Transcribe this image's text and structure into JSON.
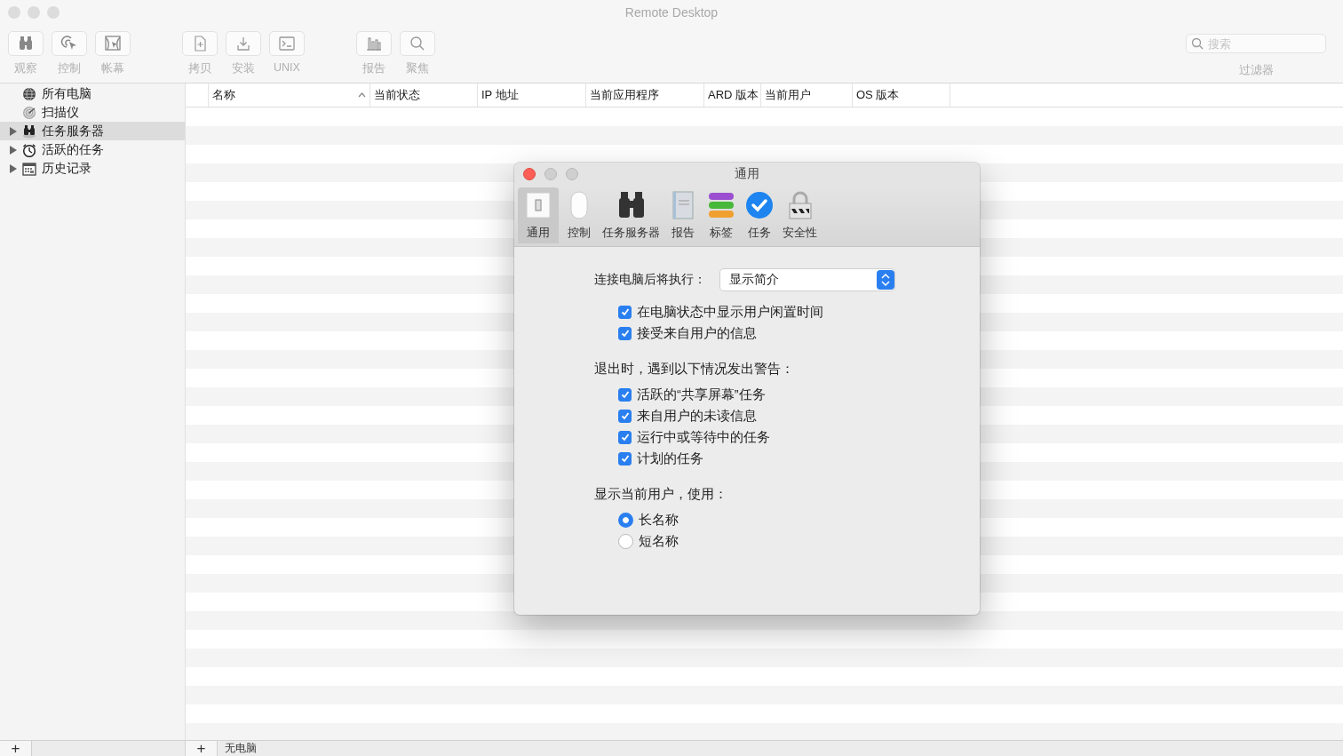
{
  "window": {
    "title": "Remote Desktop"
  },
  "toolbar": {
    "groups": [
      [
        {
          "label": "观察"
        },
        {
          "label": "控制"
        },
        {
          "label": "帐幕"
        }
      ],
      [
        {
          "label": "拷贝"
        },
        {
          "label": "安装"
        },
        {
          "label": "UNIX"
        }
      ],
      [
        {
          "label": "报告"
        },
        {
          "label": "聚焦"
        }
      ]
    ],
    "search": {
      "placeholder": "搜索",
      "label": "过滤器"
    }
  },
  "sidebar": {
    "items": [
      {
        "label": "所有电脑",
        "expandable": false,
        "selected": false
      },
      {
        "label": "扫描仪",
        "expandable": false,
        "selected": false
      },
      {
        "label": "任务服务器",
        "expandable": true,
        "selected": true
      },
      {
        "label": "活跃的任务",
        "expandable": true,
        "selected": false
      },
      {
        "label": "历史记录",
        "expandable": true,
        "selected": false
      }
    ]
  },
  "table": {
    "columns": [
      {
        "label": "名称",
        "sorted": true
      },
      {
        "label": "当前状态",
        "sorted": false
      },
      {
        "label": "IP 地址",
        "sorted": false
      },
      {
        "label": "当前应用程序",
        "sorted": false
      },
      {
        "label": "ARD 版本",
        "sorted": false
      },
      {
        "label": "当前用户",
        "sorted": false
      },
      {
        "label": "OS 版本",
        "sorted": false
      }
    ]
  },
  "status_bar": {
    "left_button": "+",
    "right_button": "+",
    "text": "无电脑"
  },
  "dialog": {
    "title": "通用",
    "tabs": [
      {
        "label": "通用",
        "selected": true
      },
      {
        "label": "控制",
        "selected": false
      },
      {
        "label": "任务服务器",
        "selected": false
      },
      {
        "label": "报告",
        "selected": false
      },
      {
        "label": "标签",
        "selected": false
      },
      {
        "label": "任务",
        "selected": false
      },
      {
        "label": "安全性",
        "selected": false
      }
    ],
    "popup": {
      "label": "连接电脑后将执行：",
      "value": "显示简介"
    },
    "options": [
      {
        "label": "在电脑状态中显示用户闲置时间",
        "checked": true
      },
      {
        "label": "接受来自用户的信息",
        "checked": true
      }
    ],
    "warnings_heading": "退出时，遇到以下情况发出警告：",
    "warnings": [
      {
        "label": "活跃的“共享屏幕”任务",
        "checked": true
      },
      {
        "label": "来自用户的未读信息",
        "checked": true
      },
      {
        "label": "运行中或等待中的任务",
        "checked": true
      },
      {
        "label": "计划的任务",
        "checked": true
      }
    ],
    "user_heading": "显示当前用户，使用：",
    "user_names": [
      {
        "label": "长名称",
        "selected": true
      },
      {
        "label": "短名称",
        "selected": false
      }
    ]
  }
}
